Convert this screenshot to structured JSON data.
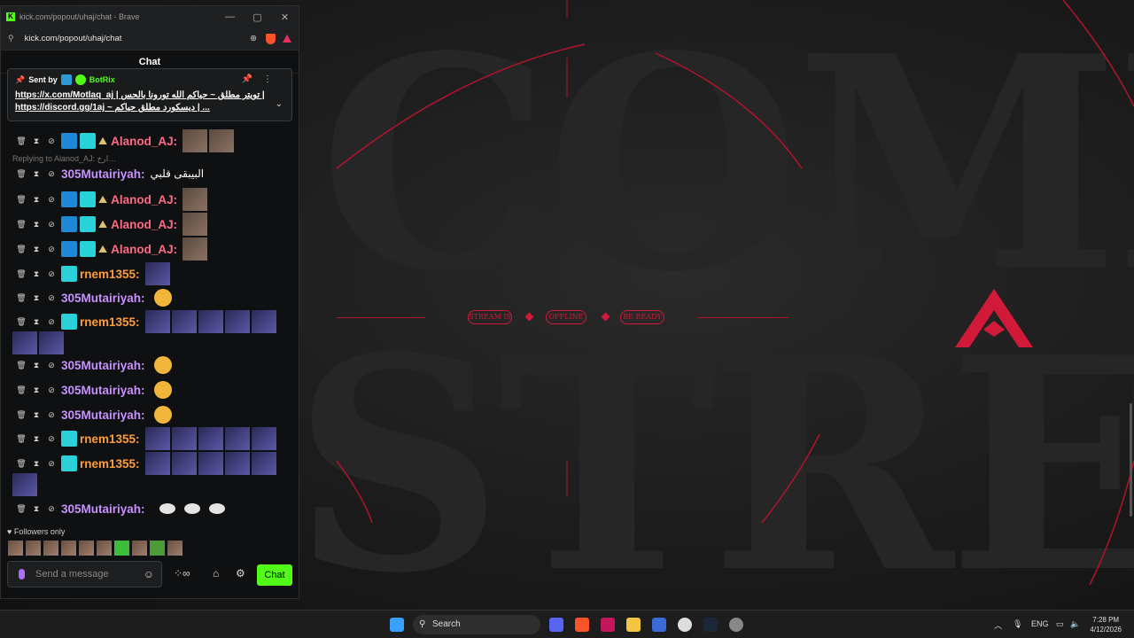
{
  "browser": {
    "title": "kick.com/popout/uhaj/chat - Brave",
    "url": "kick.com/popout/uhaj/chat",
    "window_controls": [
      "minimize",
      "maximize",
      "close"
    ]
  },
  "chat": {
    "header": "Chat",
    "pinned": {
      "sent_by_label": "Sent by",
      "sender": "BotRix",
      "line1": "https://x.com/Motlaq_aj | تويتر مطلق ~ حياكم الله تورونا بالحس |",
      "line2": "https://discord.gg/1aj ~ ديسكورد مطلق حياكم | ..."
    },
    "reply_note": "Replying to Alanod_AJ: ارخ…",
    "messages": [
      {
        "user": "Alanod_AJ:",
        "type": "emotes"
      },
      {
        "user": "305Mutairiyah:",
        "text": "البيبقى قلبي"
      },
      {
        "user": "Alanod_AJ:",
        "type": "emotes"
      },
      {
        "user": "Alanod_AJ:",
        "type": "emotes"
      },
      {
        "user": "Alanod_AJ:",
        "type": "emotes"
      },
      {
        "user": "rnem1355:",
        "type": "emotes"
      },
      {
        "user": "305Mutairiyah:",
        "type": "emoji"
      },
      {
        "user": "rnem1355:",
        "type": "emotes"
      },
      {
        "user": "305Mutairiyah:",
        "type": "emoji"
      },
      {
        "user": "305Mutairiyah:",
        "type": "emoji"
      },
      {
        "user": "305Mutairiyah:",
        "type": "emoji"
      },
      {
        "user": "rnem1355:",
        "type": "emotes"
      },
      {
        "user": "rnem1355:",
        "type": "emotes"
      },
      {
        "user": "305Mutairiyah:",
        "type": "emotes"
      }
    ],
    "followers_only": "Followers only",
    "input_placeholder": "Send a message",
    "send_button": "Chat"
  },
  "overlay": {
    "pills": [
      "STREAM IS",
      "OFFLINE",
      "BE READY"
    ],
    "big_top": "COME",
    "big_bottom": "STREA"
  },
  "taskbar": {
    "search_label": "Search",
    "language": "ENG",
    "time": "7:28 PM",
    "date": "4/12/2026"
  },
  "colors": {
    "kick_green": "#53fc18",
    "accent_red": "#d11a3a",
    "name_pink": "#ff6b86",
    "name_violet": "#c792ff",
    "name_orange": "#ff9d3a"
  }
}
